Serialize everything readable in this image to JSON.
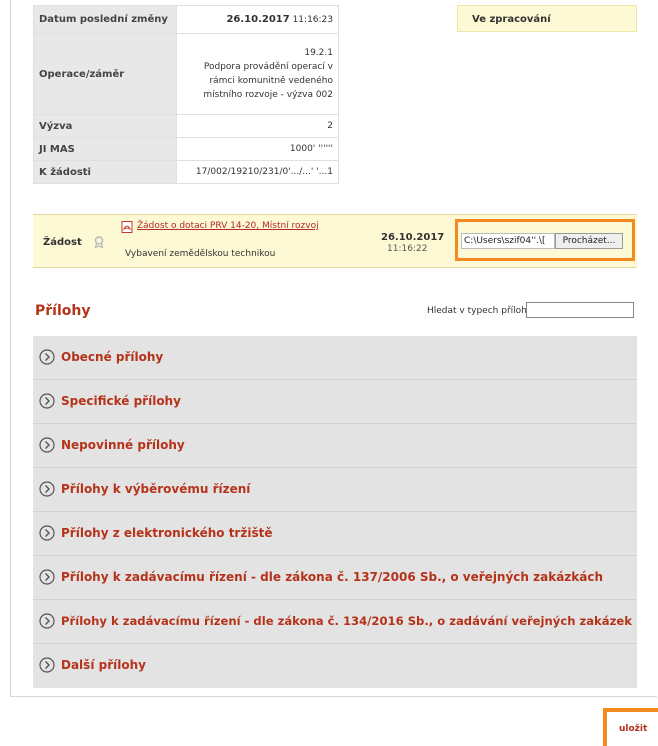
{
  "info": {
    "date_label": "Datum poslední změny",
    "date_value": "26.10.2017",
    "date_time": "11:16:23",
    "operation_label": "Operace/záměr",
    "operation_lines": [
      "19.2.1",
      "Podpora provádění operací v",
      "rámci komunitně vedeného",
      "místního rozvoje - výzva 002"
    ],
    "call_label": "Výzva",
    "call_value": "2",
    "jimas_label": "JI MAS",
    "jimas_value": "1000' ''''''",
    "request_label": "K žádosti",
    "request_value": "17/002/19210/231/0'.../...' '...1"
  },
  "status": "Ve zpracování",
  "zadost": {
    "label": "Žádost",
    "link": "Žádost o dotaci PRV 14-20, Místní rozvoj",
    "subtitle": "Vybavení zemědělskou technikou",
    "date": "26.10.2017",
    "time": "11:16:22",
    "file_path": "C:\\Users\\szif04''.\\[",
    "browse_label": "Procházet..."
  },
  "prilohy": {
    "title": "Přílohy",
    "search_label": "Hledat v typech příloh:",
    "search_value": "",
    "sections": [
      "Obecné přílohy",
      "Specifické přílohy",
      "Nepovinné přílohy",
      "Přílohy k výběrovému řízení",
      "Přílohy z elektronického tržiště",
      "Přílohy k zadávacímu řízení - dle zákona č. 137/2006 Sb., o veřejných zakázkách",
      "Přílohy k zadávacímu řízení - dle zákona č. 134/2016 Sb., o zadávání veřejných zakázek",
      "Další přílohy"
    ]
  },
  "save_label": "uložit",
  "colors": {
    "accent": "#b5331a",
    "highlight": "#f28a1f",
    "pale_yellow": "#fdf9d4"
  },
  "icons": {
    "section": "chevron-circle-icon",
    "document": "pdf-icon",
    "award": "award-icon"
  }
}
